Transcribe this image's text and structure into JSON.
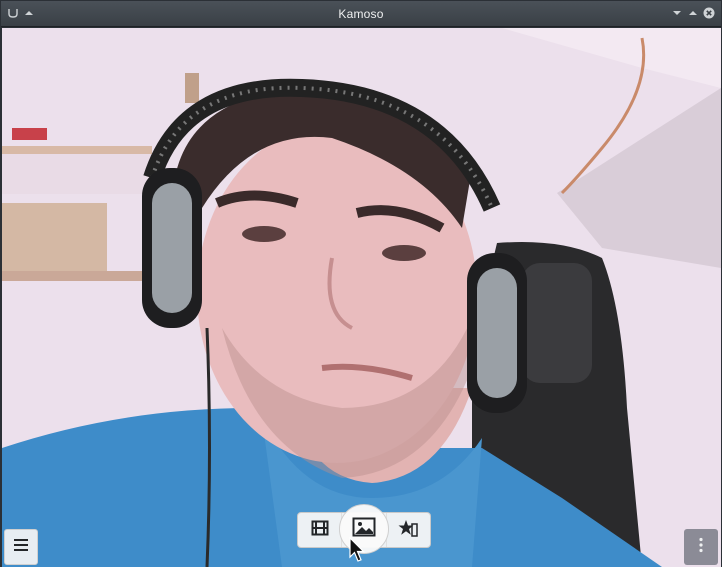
{
  "window": {
    "title": "Kamoso"
  },
  "titlebar": {
    "left_icons": [
      "app-menu-icon",
      "keep-above-icon"
    ],
    "right_icons": [
      "minimize-icon",
      "maximize-icon",
      "close-icon"
    ]
  },
  "controls": {
    "menu_icon": "hamburger-menu-icon",
    "more_icon": "vertical-ellipsis-icon",
    "modes": [
      {
        "name": "video",
        "icon": "film-strip-icon"
      },
      {
        "name": "photo",
        "icon": "image-icon",
        "active": true
      },
      {
        "name": "burst",
        "icon": "star-icon"
      }
    ]
  },
  "colors": {
    "titlebar": "#3a4046",
    "title_text": "#eff0f1",
    "control_bg": "#f6f6f6",
    "icon": "#232629"
  }
}
